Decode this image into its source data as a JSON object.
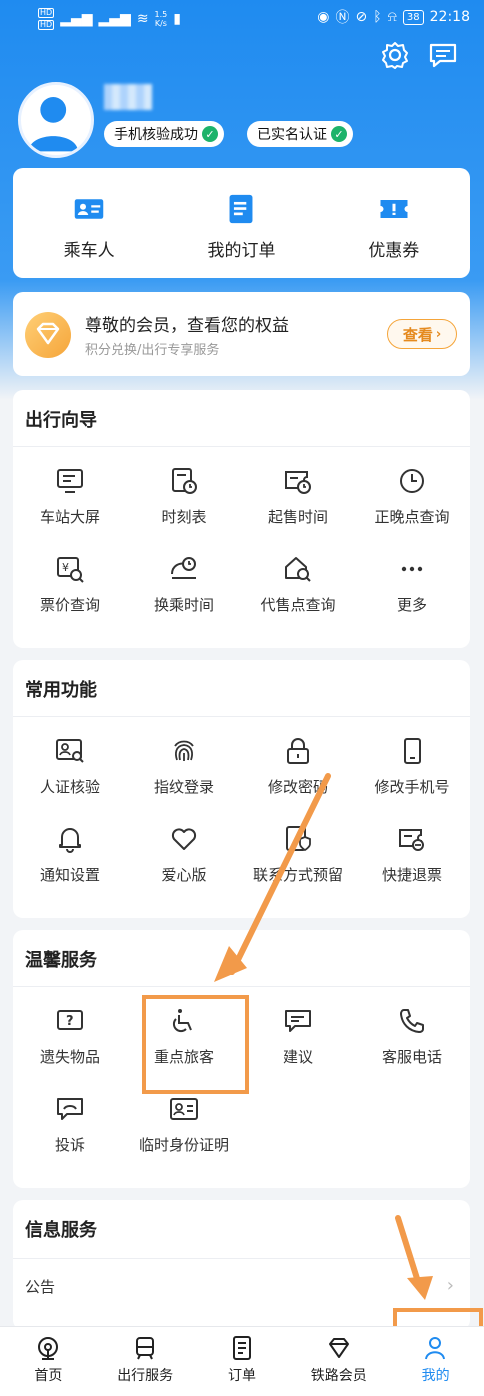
{
  "status_bar": {
    "left_badges": [
      "HD",
      "HD"
    ],
    "speed": "1.5",
    "speed_unit": "K/s",
    "battery": "38",
    "time": "22:18"
  },
  "profile": {
    "badges": [
      "手机核验成功",
      "已实名认证"
    ]
  },
  "quick_actions": [
    {
      "label": "乘车人",
      "icon": "passenger-card-icon"
    },
    {
      "label": "我的订单",
      "icon": "order-list-icon"
    },
    {
      "label": "优惠券",
      "icon": "coupon-icon"
    }
  ],
  "member": {
    "title": "尊敬的会员，查看您的权益",
    "subtitle": "积分兑换/出行专享服务",
    "view_label": "查看",
    "accent": "#f5a53a"
  },
  "sections": {
    "guide": {
      "title": "出行向导",
      "items": [
        "车站大屏",
        "时刻表",
        "起售时间",
        "正晚点查询",
        "票价查询",
        "换乘时间",
        "代售点查询",
        "更多"
      ]
    },
    "common": {
      "title": "常用功能",
      "items": [
        "人证核验",
        "指纹登录",
        "修改密码",
        "修改手机号",
        "通知设置",
        "爱心版",
        "联系方式预留",
        "快捷退票"
      ]
    },
    "warm": {
      "title": "温馨服务",
      "items": [
        "遗失物品",
        "重点旅客",
        "建议",
        "客服电话",
        "投诉",
        "临时身份证明"
      ]
    },
    "info": {
      "title": "信息服务",
      "rows": [
        "公告"
      ]
    }
  },
  "tabbar": {
    "tabs": [
      {
        "label": "首页",
        "icon": "home-icon"
      },
      {
        "label": "出行服务",
        "icon": "train-icon"
      },
      {
        "label": "订单",
        "icon": "order-icon"
      },
      {
        "label": "铁路会员",
        "icon": "diamond-icon"
      },
      {
        "label": "我的",
        "icon": "profile-icon"
      }
    ]
  },
  "colors": {
    "primary": "#1f8bf0",
    "highlight": "#f29a4a",
    "success": "#1db36a"
  }
}
